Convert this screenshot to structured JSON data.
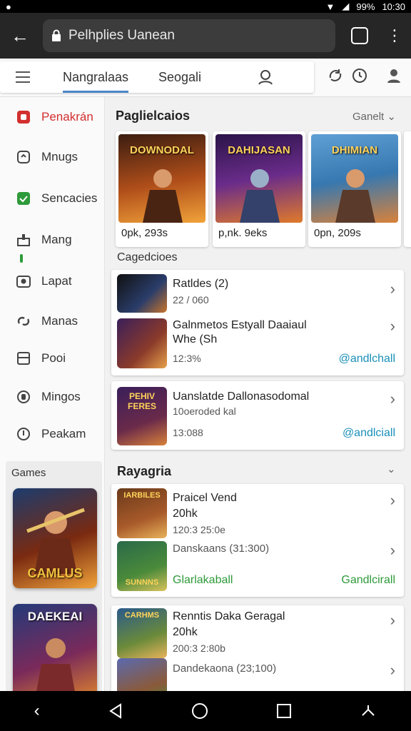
{
  "status": {
    "time": "10:30",
    "battery": "99%"
  },
  "urlbar": {
    "url": "Pelhplies Uanean"
  },
  "topnav": {
    "tabs": [
      {
        "label": "Nangralaas"
      },
      {
        "label": "Seogali"
      }
    ]
  },
  "sidebar": {
    "items": [
      {
        "label": "Penakrán",
        "icon": "red-square-icon"
      },
      {
        "label": "Mnugs",
        "icon": "chat-icon"
      },
      {
        "label": "Sencacies",
        "icon": "green-check-icon"
      },
      {
        "label": "Mang",
        "icon": "bar-icon"
      },
      {
        "label": "Lapat",
        "icon": "camera-icon"
      },
      {
        "label": "Manas",
        "icon": "link-icon"
      },
      {
        "label": "Pooi",
        "icon": "box-icon"
      },
      {
        "label": "Mingos",
        "icon": "circle-icon"
      },
      {
        "label": "Peakam",
        "icon": "info-icon"
      }
    ],
    "games_label": "Games",
    "games": [
      {
        "title": "CAMLUS"
      },
      {
        "title": "DAEKEAI"
      }
    ]
  },
  "main": {
    "featured": {
      "title": "Paglielcaios",
      "action": "Ganelt",
      "cards": [
        {
          "banner": "DOWNODAL",
          "caption": "0pk, 293s",
          "color": "#b04e1a"
        },
        {
          "banner": "DAHIJASAN",
          "caption": "p,nk. 9eks",
          "color": "#6a2c8a"
        },
        {
          "banner": "DHIMIAN",
          "caption": "0pn, 209s",
          "color": "#3778b0"
        }
      ]
    },
    "categories": {
      "title": "Cagedcioes",
      "card1": [
        {
          "title": "Ratldes (2)",
          "sub": "22 / 060"
        },
        {
          "title": "Galnmetos Estyall Daaiaul Whe (Sh",
          "sub": "12:3%",
          "link": "@andlchall"
        }
      ],
      "card2": [
        {
          "title": "Uanslatde Dallonasodomal",
          "sub2": "10oeroded kal",
          "sub": "13:088",
          "link": "@andlciall",
          "thumb": "PEHIV FERES"
        }
      ]
    },
    "rayagria": {
      "title": "Rayagria",
      "card1": [
        {
          "title": "Praicel Vend",
          "sub2": "20hk",
          "sub": "120:3 25:0e",
          "thumb": "IARBILES"
        },
        {
          "title": "Danskaans (31:300)",
          "green": "Glarlakaball",
          "link": "Gandlcirall",
          "thumb": "SUNNNS"
        }
      ],
      "card2": [
        {
          "title": "Renntis Daka Geragal",
          "sub2": "20hk",
          "sub": "200:3 2:80b",
          "thumb": "CARHMS"
        },
        {
          "title": "Dandekaona (23;100)",
          "thumb": ""
        }
      ]
    }
  }
}
